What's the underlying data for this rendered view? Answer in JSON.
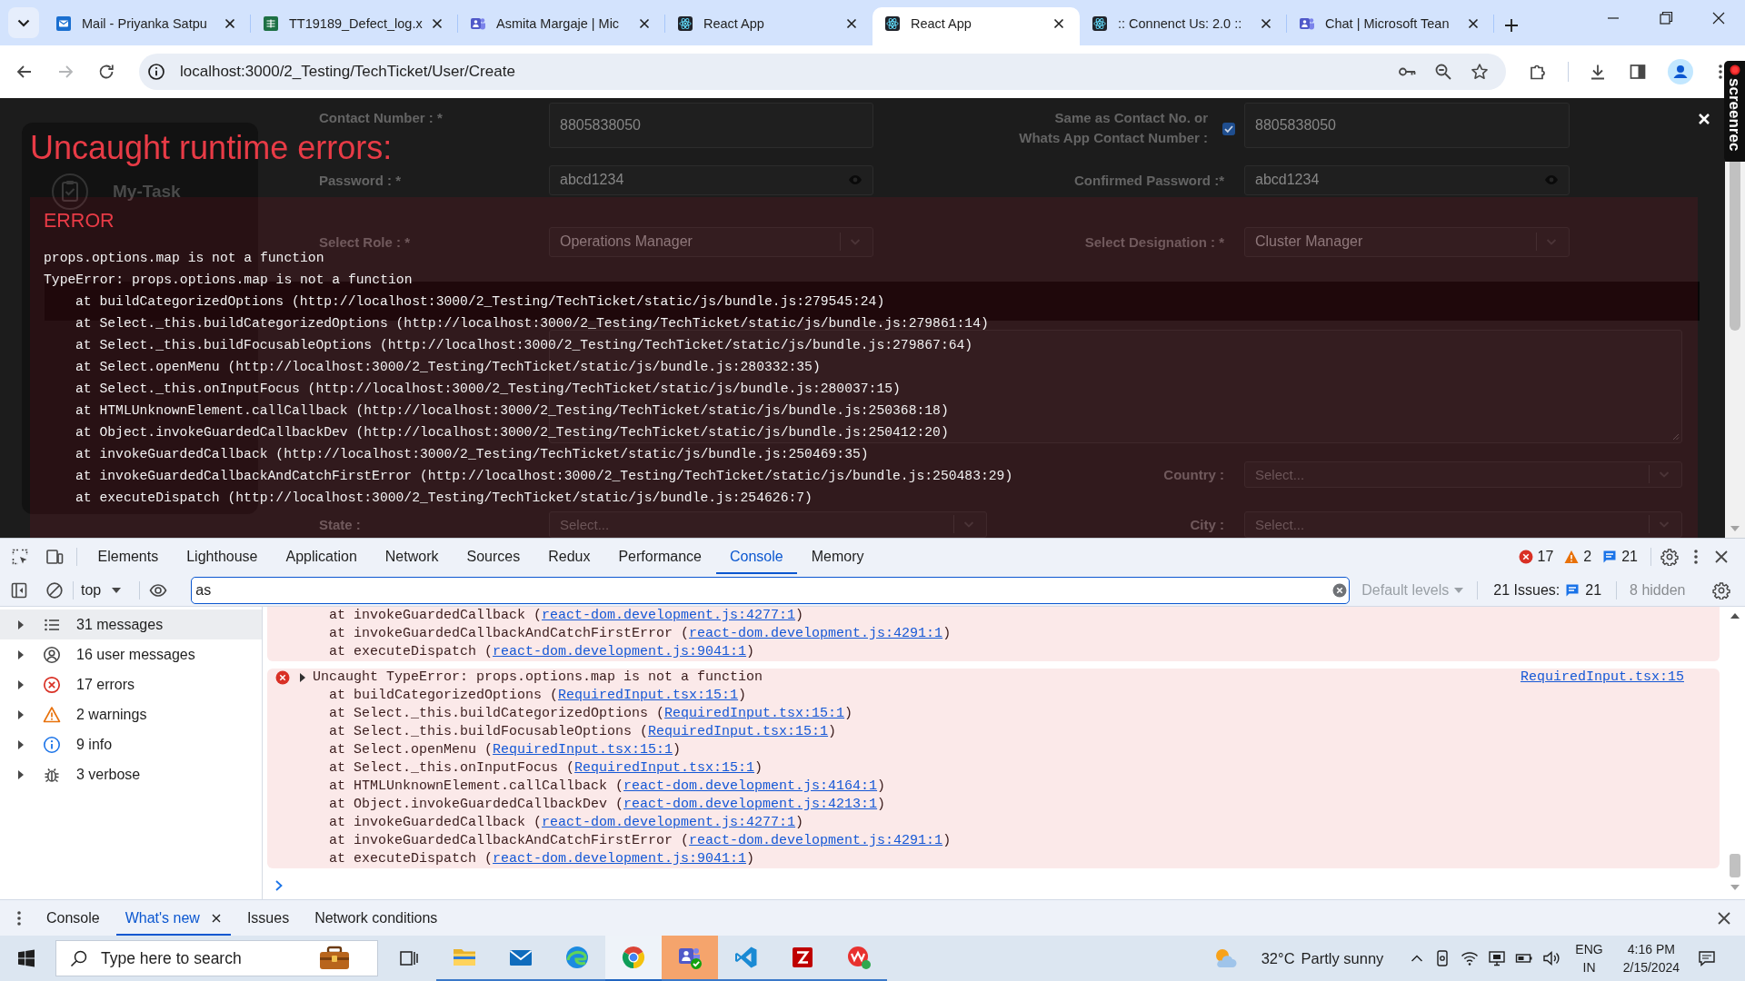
{
  "browser": {
    "tabs": [
      {
        "title": "Mail - Priyanka Satpu",
        "kind": "outlook",
        "selected": false
      },
      {
        "title": "TT19189_Defect_log.x",
        "kind": "excel",
        "selected": false
      },
      {
        "title": "Asmita Margaje | Mic",
        "kind": "teams",
        "selected": false
      },
      {
        "title": "React App",
        "kind": "react",
        "selected": false
      },
      {
        "title": "React App",
        "kind": "react",
        "selected": true
      },
      {
        "title": ":: Connenct Us: 2.0 ::",
        "kind": "react",
        "selected": false
      },
      {
        "title": "Chat | Microsoft Tean",
        "kind": "teams",
        "selected": false
      }
    ],
    "navigation": {
      "back_disabled": false,
      "forward_disabled": true
    },
    "url": "localhost:3000/2_Testing/TechTicket/User/Create"
  },
  "screen_recorder": {
    "label": "screenrec"
  },
  "page": {
    "brand": "My-Task",
    "top_rows": [
      {
        "left": {
          "label": "Contact Number : *",
          "kind": "text",
          "value": "8805838050"
        },
        "right": {
          "label_lines": [
            "Same as Contact No. or",
            "Whats App Contact Number :"
          ],
          "checkbox": {
            "checked": true
          },
          "kind": "text",
          "value": "8805838050"
        }
      },
      {
        "left": {
          "label": "Password : *",
          "kind": "password",
          "value": "abcd1234"
        },
        "right": {
          "label": "Confirmed Password :*",
          "kind": "password",
          "value": "abcd1234"
        }
      },
      {
        "left": {
          "label": "Select Role : *",
          "kind": "select",
          "value": "Operations Manager"
        },
        "right": {
          "label": "Select Designation : *",
          "kind": "select",
          "value": "Cluster Manager"
        }
      }
    ],
    "address_rows": [
      {
        "right": {
          "label": "Country :",
          "kind": "select",
          "placeholder": "Select..."
        }
      },
      {
        "left": {
          "label": "State :",
          "kind": "select",
          "placeholder": "Select..."
        },
        "right": {
          "label": "City :",
          "kind": "select",
          "placeholder": "Select..."
        }
      }
    ]
  },
  "error_overlay": {
    "title": "Uncaught runtime errors:",
    "errors": [
      {
        "label": "ERROR",
        "message_lines": [
          "props.options.map is not a function",
          "TypeError: props.options.map is not a function"
        ],
        "stack": [
          "at buildCategorizedOptions (http://localhost:3000/2_Testing/TechTicket/static/js/bundle.js:279545:24)",
          "at Select._this.buildCategorizedOptions (http://localhost:3000/2_Testing/TechTicket/static/js/bundle.js:279861:14)",
          "at Select._this.buildFocusableOptions (http://localhost:3000/2_Testing/TechTicket/static/js/bundle.js:279867:64)",
          "at Select.openMenu (http://localhost:3000/2_Testing/TechTicket/static/js/bundle.js:280332:35)",
          "at Select._this.onInputFocus (http://localhost:3000/2_Testing/TechTicket/static/js/bundle.js:280037:15)",
          "at HTMLUnknownElement.callCallback (http://localhost:3000/2_Testing/TechTicket/static/js/bundle.js:250368:18)",
          "at Object.invokeGuardedCallbackDev (http://localhost:3000/2_Testing/TechTicket/static/js/bundle.js:250412:20)",
          "at invokeGuardedCallback (http://localhost:3000/2_Testing/TechTicket/static/js/bundle.js:250469:35)",
          "at invokeGuardedCallbackAndCatchFirstError (http://localhost:3000/2_Testing/TechTicket/static/js/bundle.js:250483:29)",
          "at executeDispatch (http://localhost:3000/2_Testing/TechTicket/static/js/bundle.js:254626:7)"
        ]
      }
    ]
  },
  "devtools": {
    "panel_tabs": [
      {
        "label": "Elements",
        "selected": false
      },
      {
        "label": "Lighthouse",
        "selected": false
      },
      {
        "label": "Application",
        "selected": false
      },
      {
        "label": "Network",
        "selected": false
      },
      {
        "label": "Sources",
        "selected": false
      },
      {
        "label": "Redux",
        "selected": false
      },
      {
        "label": "Performance",
        "selected": false
      },
      {
        "label": "Console",
        "selected": true
      },
      {
        "label": "Memory",
        "selected": false
      }
    ],
    "counts": {
      "errors": "17",
      "warnings": "2",
      "messages": "21"
    },
    "context": "top",
    "filter": {
      "value": "as"
    },
    "levels": "Default levels",
    "issues": {
      "label": "21 Issues:",
      "count": "21"
    },
    "hidden": "8 hidden",
    "sidebar": [
      {
        "kind": "all",
        "label": "31 messages",
        "selected": true
      },
      {
        "kind": "user",
        "label": "16 user messages",
        "selected": false
      },
      {
        "kind": "error",
        "label": "17 errors",
        "selected": false
      },
      {
        "kind": "warning",
        "label": "2 warnings",
        "selected": false
      },
      {
        "kind": "info",
        "label": "9 info",
        "selected": false
      },
      {
        "kind": "verbose",
        "label": "3 verbose",
        "selected": false
      }
    ],
    "messages": [
      {
        "kind": "error",
        "frames": [
          {
            "text": "at invokeGuardedCallback (",
            "link": "react-dom.development.js:4277:1",
            "end": ")"
          },
          {
            "text": "at invokeGuardedCallbackAndCatchFirstError (",
            "link": "react-dom.development.js:4291:1",
            "end": ")"
          },
          {
            "text": "at executeDispatch (",
            "link": "react-dom.development.js:9041:1",
            "end": ")"
          }
        ]
      },
      {
        "kind": "error",
        "header": "Uncaught TypeError: props.options.map is not a function",
        "source": "RequiredInput.tsx:15",
        "frames": [
          {
            "text": "at buildCategorizedOptions (",
            "link": "RequiredInput.tsx:15:1",
            "end": ")"
          },
          {
            "text": "at Select._this.buildCategorizedOptions (",
            "link": "RequiredInput.tsx:15:1",
            "end": ")"
          },
          {
            "text": "at Select._this.buildFocusableOptions (",
            "link": "RequiredInput.tsx:15:1",
            "end": ")"
          },
          {
            "text": "at Select.openMenu (",
            "link": "RequiredInput.tsx:15:1",
            "end": ")"
          },
          {
            "text": "at Select._this.onInputFocus (",
            "link": "RequiredInput.tsx:15:1",
            "end": ")"
          },
          {
            "text": "at HTMLUnknownElement.callCallback (",
            "link": "react-dom.development.js:4164:1",
            "end": ")"
          },
          {
            "text": "at Object.invokeGuardedCallbackDev (",
            "link": "react-dom.development.js:4213:1",
            "end": ")"
          },
          {
            "text": "at invokeGuardedCallback (",
            "link": "react-dom.development.js:4277:1",
            "end": ")"
          },
          {
            "text": "at invokeGuardedCallbackAndCatchFirstError (",
            "link": "react-dom.development.js:4291:1",
            "end": ")"
          },
          {
            "text": "at executeDispatch (",
            "link": "react-dom.development.js:9041:1",
            "end": ")"
          }
        ]
      }
    ],
    "drawer_tabs": [
      {
        "label": "Console",
        "selected": false,
        "closable": false
      },
      {
        "label": "What's new",
        "selected": true,
        "closable": true
      },
      {
        "label": "Issues",
        "selected": false,
        "closable": false
      },
      {
        "label": "Network conditions",
        "selected": false,
        "closable": false
      }
    ]
  },
  "taskbar": {
    "search": {
      "placeholder": "Type here to search"
    },
    "apps": [
      {
        "kind": "explorer",
        "running": true,
        "selected": false,
        "attention": false
      },
      {
        "kind": "mail",
        "running": true,
        "selected": false,
        "attention": false
      },
      {
        "kind": "edge",
        "running": true,
        "selected": false,
        "attention": false
      },
      {
        "kind": "chrome",
        "running": true,
        "selected": true,
        "attention": false
      },
      {
        "kind": "teams",
        "running": true,
        "selected": false,
        "attention": true
      },
      {
        "kind": "vscode",
        "running": true,
        "selected": false,
        "attention": false
      },
      {
        "kind": "filezilla",
        "running": true,
        "selected": false,
        "attention": false
      },
      {
        "kind": "wps",
        "running": true,
        "selected": false,
        "attention": false
      }
    ],
    "weather": {
      "temperature": "32°C",
      "condition": "Partly sunny"
    },
    "language": [
      "ENG",
      "IN"
    ],
    "clock": {
      "time": "4:16 PM",
      "date": "2/15/2024"
    }
  }
}
